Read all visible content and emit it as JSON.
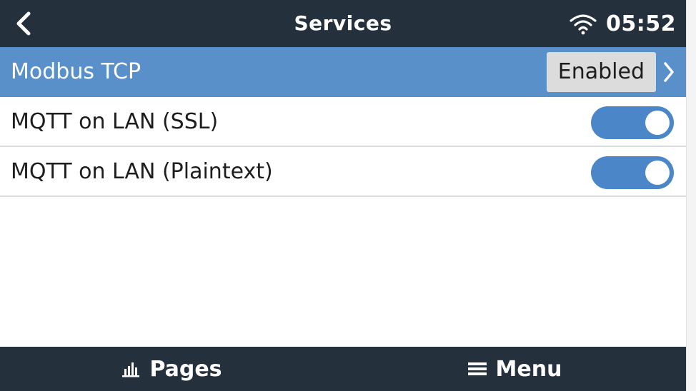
{
  "header": {
    "title": "Services",
    "time": "05:52",
    "back_icon": "chevron-left-icon",
    "wifi_icon": "wifi-icon"
  },
  "list": {
    "items": [
      {
        "label": "Modbus TCP",
        "value": "Enabled",
        "type": "submenu",
        "selected": true
      },
      {
        "label": "MQTT on LAN (SSL)",
        "type": "switch",
        "state": "on"
      },
      {
        "label": "MQTT on LAN (Plaintext)",
        "type": "switch",
        "state": "on"
      }
    ]
  },
  "footer": {
    "pages_label": "Pages",
    "menu_label": "Menu",
    "pages_icon": "bar-chart-icon",
    "menu_icon": "hamburger-menu-icon"
  },
  "colors": {
    "header_bg": "#25303d",
    "selected_row": "#5a90c9",
    "toggle_on": "#4a86c8",
    "value_box": "#dcdcdc"
  }
}
